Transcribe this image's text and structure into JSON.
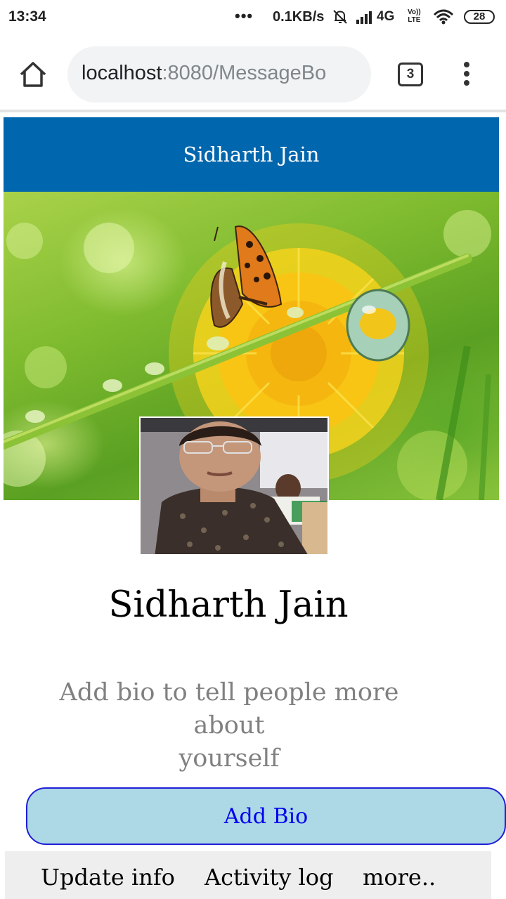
{
  "status_bar": {
    "time": "13:34",
    "more": "•••",
    "net_speed": "0.1KB/s",
    "network": "4G",
    "volte_top": "Vo))",
    "volte_bottom": "LTE",
    "battery": "28",
    "icons": [
      "bell-muted-icon",
      "signal-icon",
      "wifi-icon",
      "battery-icon"
    ]
  },
  "browser": {
    "url_host": "localhost",
    "url_path": ":8080/MessageBo",
    "tab_count": "3",
    "icons": [
      "home-icon",
      "tab-switcher-icon",
      "overflow-menu-icon"
    ]
  },
  "page": {
    "header_title": "Sidharth Jain",
    "profile_name": "Sidharth Jain",
    "bio_prompt_line1": "Add bio to tell people more about",
    "bio_prompt_line2": "yourself",
    "add_bio_label": "Add Bio"
  },
  "bottom_nav": {
    "items": [
      "Update info",
      "Activity log",
      "more.."
    ]
  },
  "colors": {
    "header_bg": "#0066ad",
    "add_bio_bg": "#add8e6",
    "add_bio_border": "#1f1fd6",
    "link_blue": "#0000ee",
    "bio_prompt": "#808080",
    "bottom_nav_bg": "#eeeeee"
  }
}
